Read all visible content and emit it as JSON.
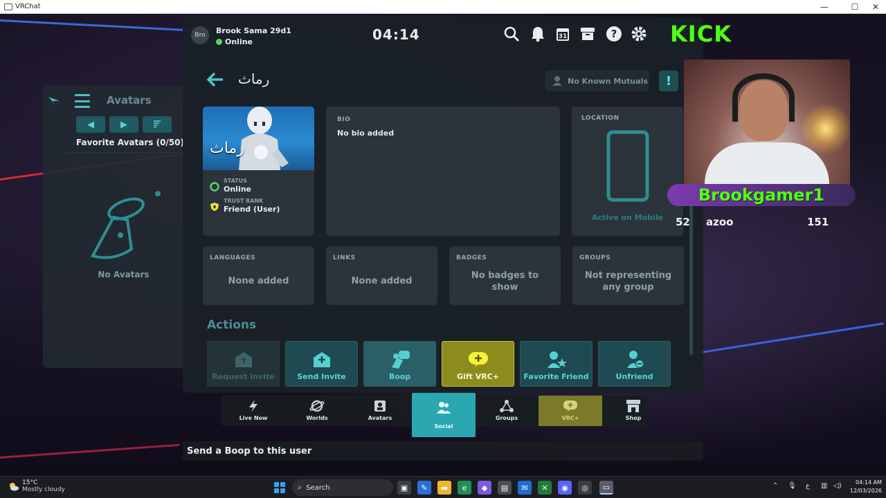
{
  "window": {
    "title": "VRChat",
    "minimize": "—",
    "maximize": "☐",
    "close": "✕"
  },
  "avatars_panel": {
    "title": "Avatars",
    "count_label": "Favorite Avatars (0/50)",
    "empty_text": "No Avatars",
    "prev": "◀",
    "next": "▶",
    "sort": "⇂"
  },
  "topbar": {
    "avatar_initials": "Bro",
    "username": "Brook Sama 29d1",
    "status": "Online",
    "clock": "04:14"
  },
  "profile": {
    "name": "رماث",
    "pic_overlay": "رماث",
    "mutuals": "No Known Mutuals",
    "report": "!",
    "status_label": "STATUS",
    "status_value": "Online",
    "trust_label": "TRUST RANK",
    "trust_value": "Friend (User)",
    "bio_label": "BIO",
    "bio_value": "No bio added",
    "location_label": "LOCATION",
    "location_value": "Active on Mobile",
    "languages_label": "LANGUAGES",
    "languages_value": "None added",
    "links_label": "LINKS",
    "links_value": "None added",
    "badges_label": "BADGES",
    "badges_value": "No badges to show",
    "groups_label": "GROUPS",
    "groups_value": "Not representing any group"
  },
  "actions": {
    "title": "Actions",
    "items": [
      {
        "label": "Request Invite",
        "icon": "envelope-question-icon",
        "state": "disabled"
      },
      {
        "label": "Send Invite",
        "icon": "envelope-plus-icon",
        "state": "normal"
      },
      {
        "label": "Boop",
        "icon": "boop-icon",
        "state": "hover"
      },
      {
        "label": "Gift VRC+",
        "icon": "gift-vrc-icon",
        "state": "gift"
      },
      {
        "label": "Favorite Friend",
        "icon": "favorite-friend-icon",
        "state": "normal"
      },
      {
        "label": "Unfriend",
        "icon": "unfriend-icon",
        "state": "normal"
      }
    ]
  },
  "nav": {
    "items": [
      {
        "label": "Live Now",
        "icon": "lightning-icon"
      },
      {
        "label": "Worlds",
        "icon": "planet-icon"
      },
      {
        "label": "Avatars",
        "icon": "avatars-icon"
      },
      {
        "label": "Social",
        "icon": "social-icon",
        "active": true
      },
      {
        "label": "Groups",
        "icon": "groups-icon"
      },
      {
        "label": "VRC+",
        "icon": "vrc-plus-icon"
      },
      {
        "label": "Shop",
        "icon": "shop-icon"
      }
    ]
  },
  "tooltip": "Send a Boop to this user",
  "stream": {
    "brand": "KICK",
    "streamer": "Brookgamer1",
    "sub_left": "52",
    "sub_mid": "azoo",
    "sub_right": "151"
  },
  "taskbar": {
    "temperature": "15°C",
    "weather": "Mostly cloudy",
    "search": "Search",
    "lang": "ع",
    "time": "04:14 AM",
    "date": "12/03/2026"
  },
  "colors": {
    "accent": "#4cc8c8",
    "gift": "#c4c436",
    "kick_green": "#53fc18",
    "panel": "#1a2026"
  }
}
